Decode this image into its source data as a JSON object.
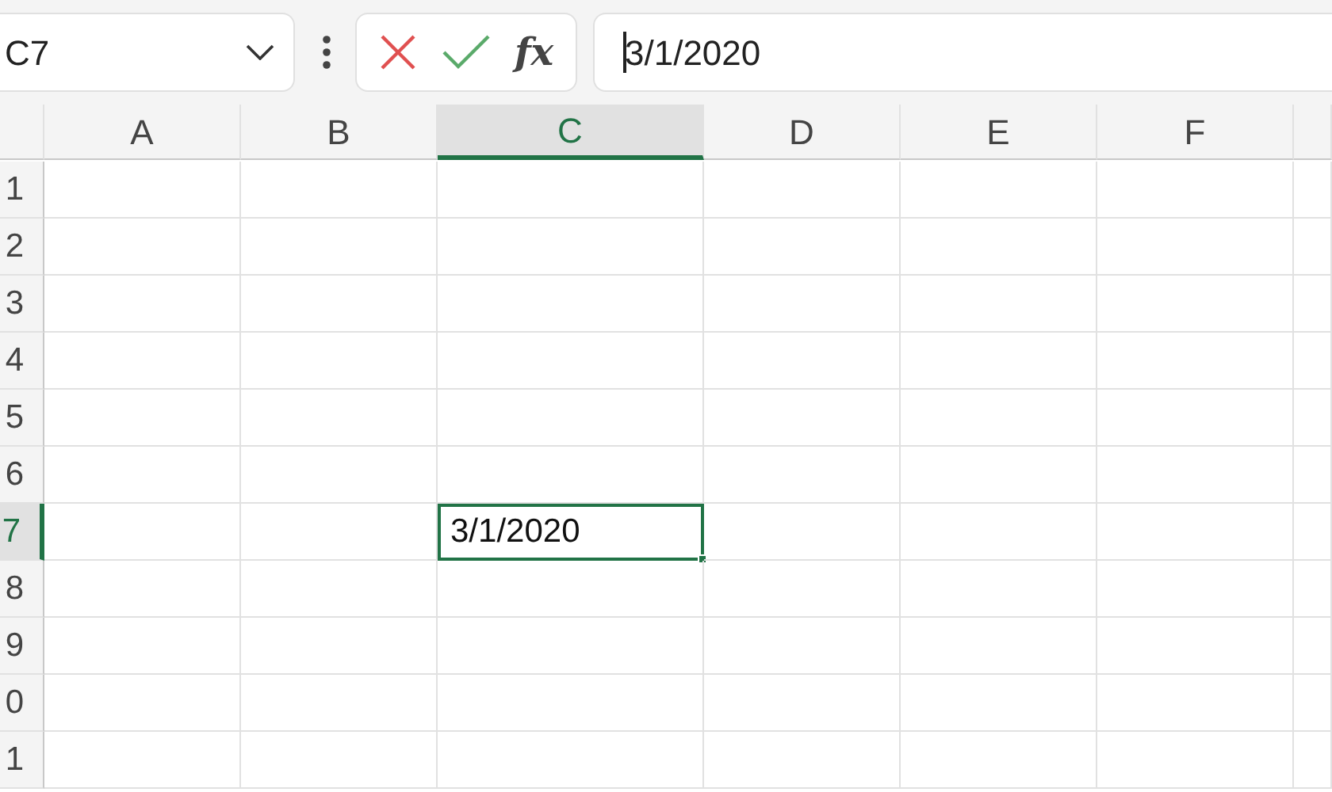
{
  "name_box": {
    "value": "C7"
  },
  "formula_bar": {
    "function_label": "fx",
    "value": "3/1/2020"
  },
  "columns": [
    {
      "label": "A",
      "selected": false
    },
    {
      "label": "B",
      "selected": false
    },
    {
      "label": "C",
      "selected": true
    },
    {
      "label": "D",
      "selected": false
    },
    {
      "label": "E",
      "selected": false
    },
    {
      "label": "F",
      "selected": false
    }
  ],
  "rows": [
    {
      "label": "1",
      "selected": false
    },
    {
      "label": "2",
      "selected": false
    },
    {
      "label": "3",
      "selected": false
    },
    {
      "label": "4",
      "selected": false
    },
    {
      "label": "5",
      "selected": false
    },
    {
      "label": "6",
      "selected": false
    },
    {
      "label": "7",
      "selected": true
    },
    {
      "label": "8",
      "selected": false
    },
    {
      "label": "9",
      "selected": false
    },
    {
      "label": "0",
      "selected": false
    },
    {
      "label": "1",
      "selected": false
    }
  ],
  "active_cell": {
    "value": "3/1/2020"
  }
}
